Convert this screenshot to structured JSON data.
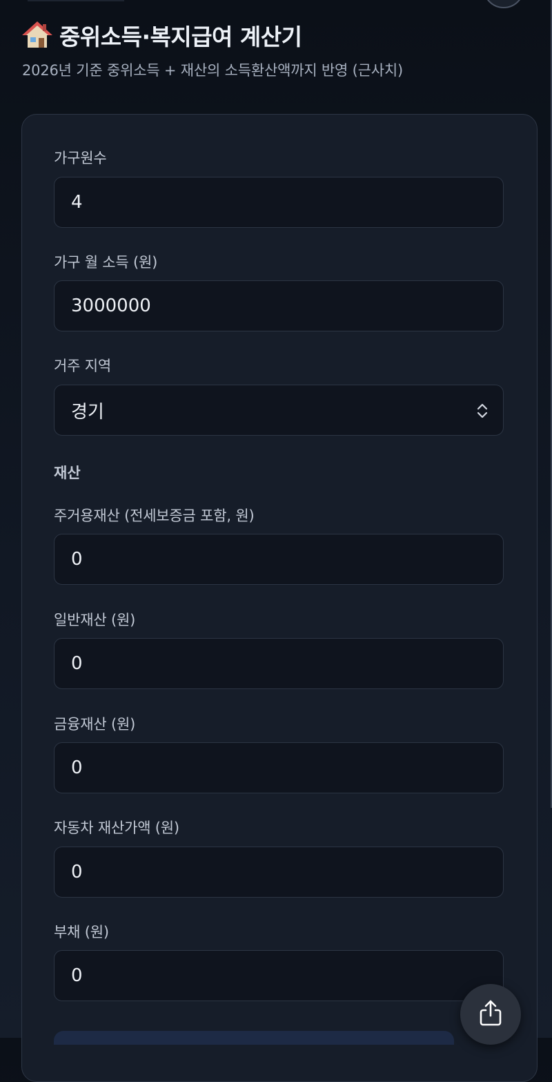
{
  "header": {
    "title": "중위소득·복지급여 계산기",
    "subtitle": "2026년 기준 중위소득 + 재산의 소득환산액까지 반영 (근사치)",
    "icon": "house-icon"
  },
  "form": {
    "household_size": {
      "label": "가구원수",
      "value": "4"
    },
    "monthly_income": {
      "label": "가구 월 소득 (원)",
      "value": "3000000"
    },
    "region": {
      "label": "거주 지역",
      "value": "경기"
    },
    "assets_section_label": "재산",
    "residential_assets": {
      "label": "주거용재산 (전세보증금 포함, 원)",
      "value": "0"
    },
    "general_assets": {
      "label": "일반재산 (원)",
      "value": "0"
    },
    "financial_assets": {
      "label": "금융재산 (원)",
      "value": "0"
    },
    "vehicle_value": {
      "label": "자동차 재산가액 (원)",
      "value": "0"
    },
    "debt": {
      "label": "부채 (원)",
      "value": "0"
    }
  },
  "fab": {
    "icon": "share-icon"
  },
  "colors": {
    "background": "#0b1018",
    "card": "#161d29",
    "input": "#0f141e",
    "border": "#2c3544",
    "text": "#eef1f6",
    "muted": "#a8b1c0"
  }
}
